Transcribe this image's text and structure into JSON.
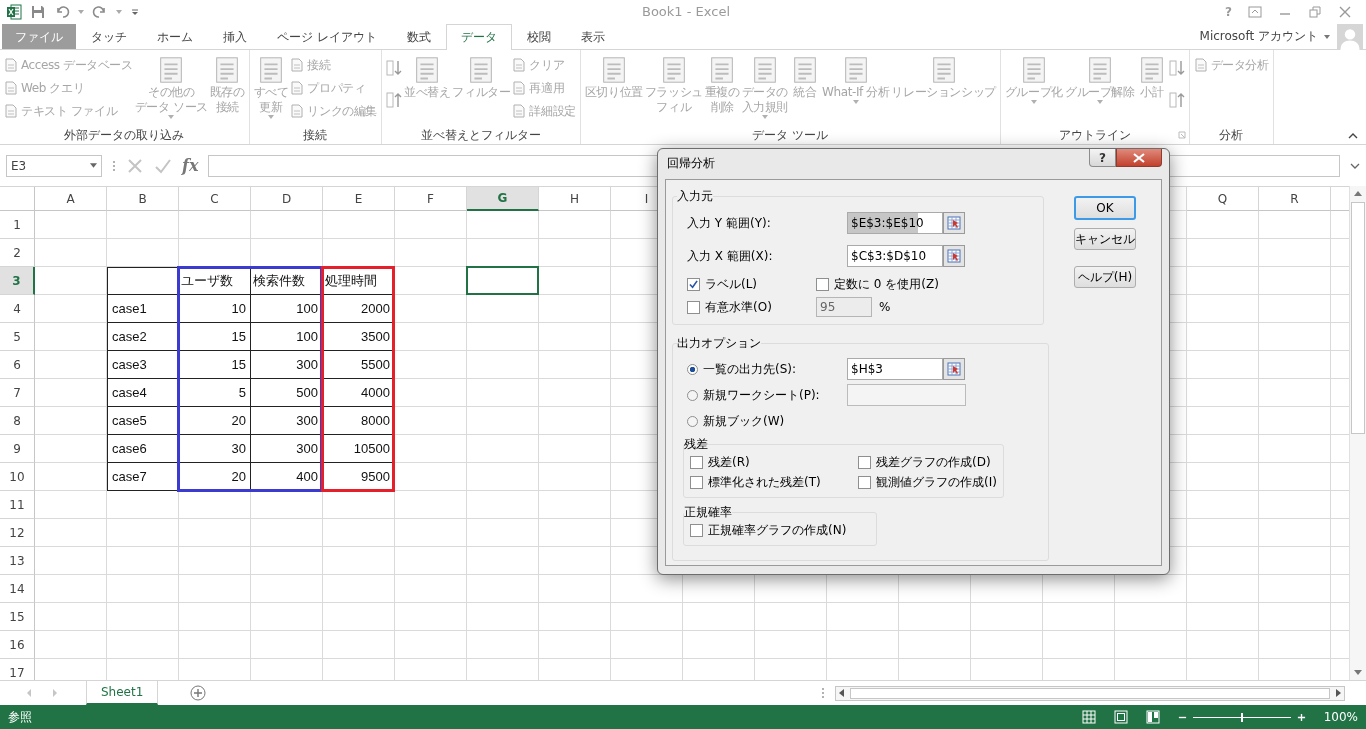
{
  "title_bar": {
    "title": "Book1 - Excel",
    "help": "?"
  },
  "tabs": [
    {
      "label": "ファイル",
      "kind": "file",
      "selected": false
    },
    {
      "label": "タッチ",
      "kind": "tab",
      "selected": false
    },
    {
      "label": "ホーム",
      "kind": "tab",
      "selected": false
    },
    {
      "label": "挿入",
      "kind": "tab",
      "selected": false
    },
    {
      "label": "ページ レイアウト",
      "kind": "tab",
      "selected": false
    },
    {
      "label": "数式",
      "kind": "tab",
      "selected": false
    },
    {
      "label": "データ",
      "kind": "tab",
      "selected": true
    },
    {
      "label": "校閲",
      "kind": "tab",
      "selected": false
    },
    {
      "label": "表示",
      "kind": "tab",
      "selected": false
    }
  ],
  "account": {
    "label": "Microsoft アカウント"
  },
  "ribbon": {
    "disabled": true,
    "groups": [
      {
        "label": "外部データの取り込み",
        "launcher": false,
        "items": [
          {
            "kind": "stack",
            "items": [
              {
                "label": "Access データベース"
              },
              {
                "label": "Web クエリ"
              },
              {
                "label": "テキスト ファイル"
              }
            ]
          },
          {
            "kind": "large",
            "lines": [
              "その他の",
              "データ ソース"
            ],
            "dropdown": true
          },
          {
            "kind": "large",
            "lines": [
              "既存の",
              "接続"
            ],
            "dropdown": false
          }
        ]
      },
      {
        "label": "接続",
        "launcher": false,
        "items": [
          {
            "kind": "large",
            "lines": [
              "すべて",
              "更新"
            ],
            "dropdown": true
          },
          {
            "kind": "stack",
            "items": [
              {
                "label": "接続"
              },
              {
                "label": "プロパティ"
              },
              {
                "label": "リンクの編集"
              }
            ]
          }
        ]
      },
      {
        "label": "並べ替えとフィルター",
        "launcher": false,
        "items": [
          {
            "kind": "icons"
          },
          {
            "kind": "large",
            "lines": [
              "並べ替え"
            ],
            "dropdown": false
          },
          {
            "kind": "large",
            "lines": [
              "フィルター"
            ],
            "dropdown": false
          },
          {
            "kind": "stack",
            "items": [
              {
                "label": "クリア"
              },
              {
                "label": "再適用"
              },
              {
                "label": "詳細設定"
              }
            ]
          }
        ]
      },
      {
        "label": "データ ツール",
        "launcher": false,
        "items": [
          {
            "kind": "large",
            "lines": [
              "区切り位置"
            ],
            "dropdown": false
          },
          {
            "kind": "large",
            "lines": [
              "フラッシュ",
              "フィル"
            ],
            "dropdown": false
          },
          {
            "kind": "large",
            "lines": [
              "重複の",
              "削除"
            ],
            "dropdown": false
          },
          {
            "kind": "large",
            "lines": [
              "データの",
              "入力規則"
            ],
            "dropdown": true
          },
          {
            "kind": "large",
            "lines": [
              "統合"
            ],
            "dropdown": false
          },
          {
            "kind": "large",
            "lines": [
              "What-If 分析"
            ],
            "dropdown": true
          },
          {
            "kind": "large",
            "lines": [
              "リレーションシップ"
            ],
            "dropdown": false
          }
        ]
      },
      {
        "label": "アウトライン",
        "launcher": true,
        "items": [
          {
            "kind": "large",
            "lines": [
              "グループ化"
            ],
            "dropdown": true
          },
          {
            "kind": "large",
            "lines": [
              "グループ解除"
            ],
            "dropdown": true
          },
          {
            "kind": "large",
            "lines": [
              "小計"
            ],
            "dropdown": false
          },
          {
            "kind": "icons"
          }
        ]
      },
      {
        "label": "分析",
        "launcher": false,
        "items": [
          {
            "kind": "stack",
            "items": [
              {
                "label": "データ分析"
              }
            ]
          }
        ]
      }
    ]
  },
  "formula_bar": {
    "name_box": "E3",
    "function_label": "fx"
  },
  "sheet": {
    "columns": [
      {
        "label": "A",
        "selected": false
      },
      {
        "label": "B",
        "selected": false
      },
      {
        "label": "C",
        "selected": false
      },
      {
        "label": "D",
        "selected": false
      },
      {
        "label": "E",
        "selected": false
      },
      {
        "label": "F",
        "selected": false
      },
      {
        "label": "G",
        "selected": true
      },
      {
        "label": "H",
        "selected": false
      },
      {
        "label": "I",
        "selected": false
      },
      {
        "label": "Q",
        "selected": false
      },
      {
        "label": "R",
        "selected": false
      }
    ],
    "rows": [
      {
        "label": "1",
        "selected": false
      },
      {
        "label": "2",
        "selected": false
      },
      {
        "label": "3",
        "selected": true
      },
      {
        "label": "4",
        "selected": false
      },
      {
        "label": "5",
        "selected": false
      },
      {
        "label": "6",
        "selected": false
      },
      {
        "label": "7",
        "selected": false
      },
      {
        "label": "8",
        "selected": false
      },
      {
        "label": "9",
        "selected": false
      },
      {
        "label": "10",
        "selected": false
      },
      {
        "label": "11",
        "selected": false
      },
      {
        "label": "12",
        "selected": false
      },
      {
        "label": "13",
        "selected": false
      },
      {
        "label": "14",
        "selected": false
      },
      {
        "label": "15",
        "selected": false
      },
      {
        "label": "16",
        "selected": false
      },
      {
        "label": "17",
        "selected": false
      }
    ],
    "table": {
      "header": [
        "ユーザ数",
        "検索件数",
        "処理時間"
      ],
      "rows": [
        {
          "name": "case1",
          "values": [
            "10",
            "100",
            "2000"
          ]
        },
        {
          "name": "case2",
          "values": [
            "15",
            "100",
            "3500"
          ]
        },
        {
          "name": "case3",
          "values": [
            "15",
            "300",
            "5500"
          ]
        },
        {
          "name": "case4",
          "values": [
            "5",
            "500",
            "4000"
          ]
        },
        {
          "name": "case5",
          "values": [
            "20",
            "300",
            "8000"
          ]
        },
        {
          "name": "case6",
          "values": [
            "30",
            "300",
            "10500"
          ]
        },
        {
          "name": "case7",
          "values": [
            "20",
            "400",
            "9500"
          ]
        }
      ]
    },
    "ranges": [
      {
        "kind": "x",
        "color": "#3b3bd1"
      },
      {
        "kind": "y",
        "color": "#e5202b"
      }
    ]
  },
  "dialog": {
    "title": "回帰分析",
    "help_button": "?",
    "input": {
      "label": "入力元",
      "ranges": [
        {
          "label": "入力 Y 範囲(Y):",
          "value": "$E$3:$E$10",
          "highlighted": true
        },
        {
          "label": "入力 X 範囲(X):",
          "value": "$C$3:$D$10",
          "highlighted": false
        }
      ],
      "options": [
        {
          "label": "ラベル(L)",
          "checked": true
        },
        {
          "label": "定数に 0 を使用(Z)",
          "checked": false
        },
        {
          "label": "有意水準(O)",
          "checked": false
        }
      ],
      "confidence": {
        "value": "95",
        "disabled": true
      },
      "unit": "%"
    },
    "output": {
      "label": "出力オプション",
      "destinations": [
        {
          "label": "一覧の出力先(S):",
          "kind": "range",
          "selected": true,
          "value": "$H$3"
        },
        {
          "label": "新規ワークシート(P):",
          "kind": "field",
          "selected": false
        },
        {
          "label": "新規ブック(W)",
          "kind": "plain",
          "selected": false
        }
      ],
      "residuals": {
        "label": "残差",
        "options": [
          {
            "label": "残差(R)",
            "checked": false
          },
          {
            "label": "残差グラフの作成(D)",
            "checked": false
          },
          {
            "label": "標準化された残差(T)",
            "checked": false
          },
          {
            "label": "観測値グラフの作成(I)",
            "checked": false
          }
        ]
      },
      "normal": {
        "label": "正規確率",
        "options": [
          {
            "label": "正規確率グラフの作成(N)",
            "checked": false
          }
        ]
      }
    },
    "buttons": [
      {
        "label": "OK",
        "default": true
      },
      {
        "label": "キャンセル",
        "default": false
      },
      {
        "label": "ヘルプ(H)",
        "default": false
      }
    ]
  },
  "sheet_tabs": [
    {
      "label": "Sheet1",
      "selected": true
    }
  ],
  "status_bar": {
    "mode": "参照",
    "zoom": {
      "level": 0.5
    },
    "zoom_label": "100%"
  }
}
